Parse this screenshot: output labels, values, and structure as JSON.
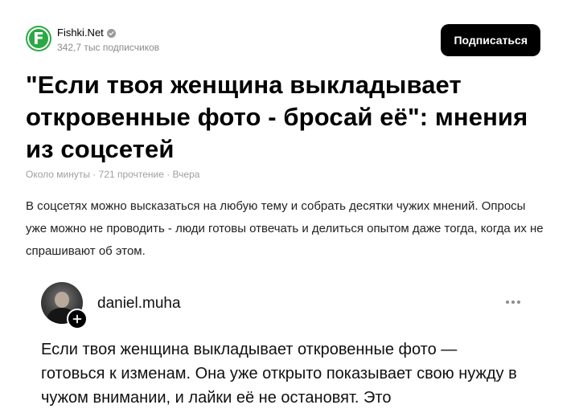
{
  "channel": {
    "name": "Fishki.Net",
    "logo_letter": "F",
    "subscribers": "342,7 тыс подписчиков",
    "logo_color": "#2aa845"
  },
  "header": {
    "subscribe_label": "Подписаться"
  },
  "article": {
    "title": "\"Если твоя женщина выкладывает откровенные фото - бросай её\": мнения из соцсетей",
    "meta": "Около минуты · 721 прочтение · Вчера",
    "lead": "В соцсетях можно высказаться на любую тему и собрать десятки чужих мнений. Опросы уже можно не проводить - люди готовы отвечать и делиться опытом даже тогда, когда их не спрашивают об этом."
  },
  "embed": {
    "username": "daniel.muha",
    "text": "Если твоя женщина выкладывает откровенные фото — готовься к изменам. Она уже открыто показывает свою нужду в чужом внимании, и лайки её не остановят. Это"
  },
  "icons": {
    "verified": "verified-check-icon",
    "follow": "plus-icon",
    "more": "more-horizontal-icon"
  }
}
